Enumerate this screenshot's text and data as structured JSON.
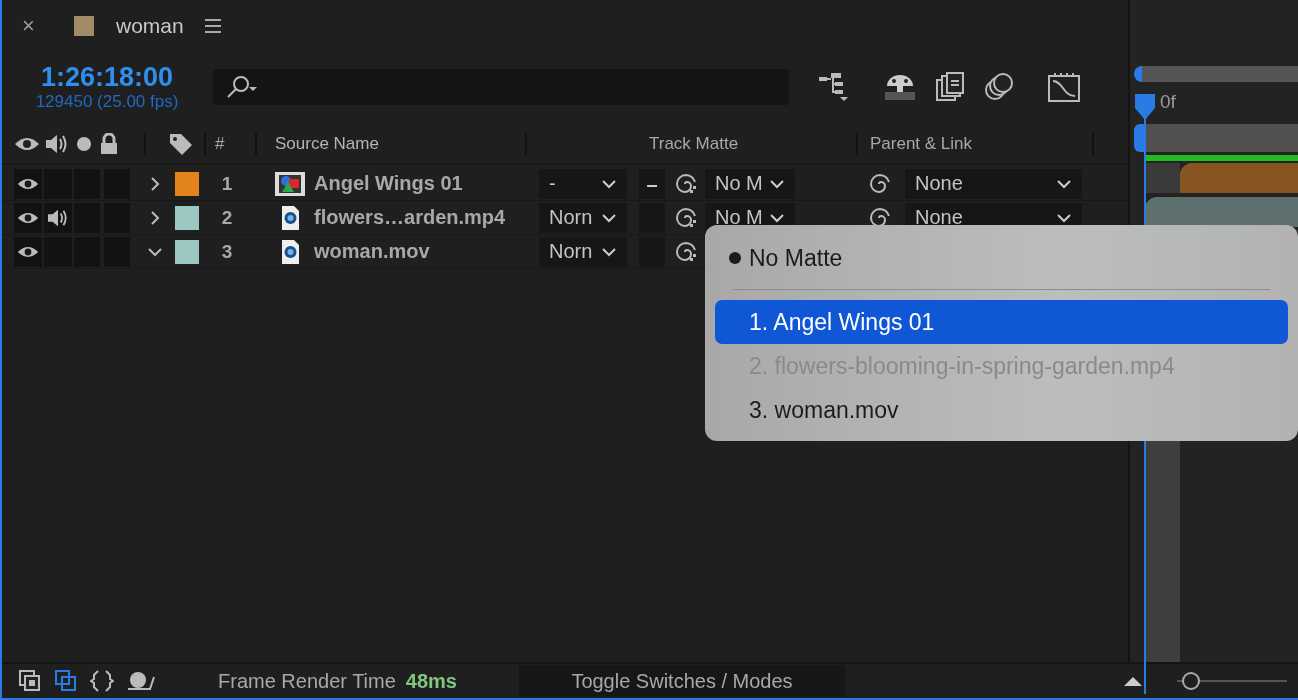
{
  "panel": {
    "close": "×",
    "title": "woman"
  },
  "timecode": "1:26:18:00",
  "frame_info": "129450 (25.00 fps)",
  "columns": {
    "number": "#",
    "source_name": "Source Name",
    "track_matte": "Track Matte",
    "parent": "Parent & Link"
  },
  "layers": [
    {
      "number": "1",
      "name": "Angel Wings 01",
      "color": "#e2841a",
      "kind": "composition",
      "expanded": false,
      "video": true,
      "audio": false,
      "solo": false,
      "lock": false,
      "mode": "-",
      "matte_flag": "–",
      "track_matte": "No M",
      "parent": "None"
    },
    {
      "number": "2",
      "name": "flowers…arden.mp4",
      "color": "#9cc7c2",
      "kind": "footage",
      "expanded": false,
      "video": true,
      "audio": true,
      "solo": false,
      "lock": false,
      "mode": "Norn",
      "track_matte": "No M",
      "parent": "None"
    },
    {
      "number": "3",
      "name": "woman.mov",
      "color": "#9cc7c2",
      "kind": "footage",
      "expanded": true,
      "video": true,
      "audio": false,
      "solo": false,
      "lock": false,
      "mode": "Norn"
    }
  ],
  "matte_menu": [
    {
      "kind": "option",
      "label": "No Matte",
      "checked": true,
      "highlighted": false,
      "disabled": false
    },
    {
      "kind": "separator"
    },
    {
      "kind": "option",
      "label": "1. Angel Wings 01",
      "checked": false,
      "highlighted": true,
      "disabled": false
    },
    {
      "kind": "option",
      "label": "2. flowers-blooming-in-spring-garden.mp4",
      "checked": false,
      "highlighted": false,
      "disabled": true
    },
    {
      "kind": "option",
      "label": "3. woman.mov",
      "checked": false,
      "highlighted": false,
      "disabled": false
    }
  ],
  "timeline": {
    "time_label": "0f"
  },
  "footer": {
    "render_label": "Frame Render Time",
    "render_time": "48ms",
    "toggle_button": "Toggle Switches / Modes",
    "zoom": {
      "level": 0.05
    }
  }
}
